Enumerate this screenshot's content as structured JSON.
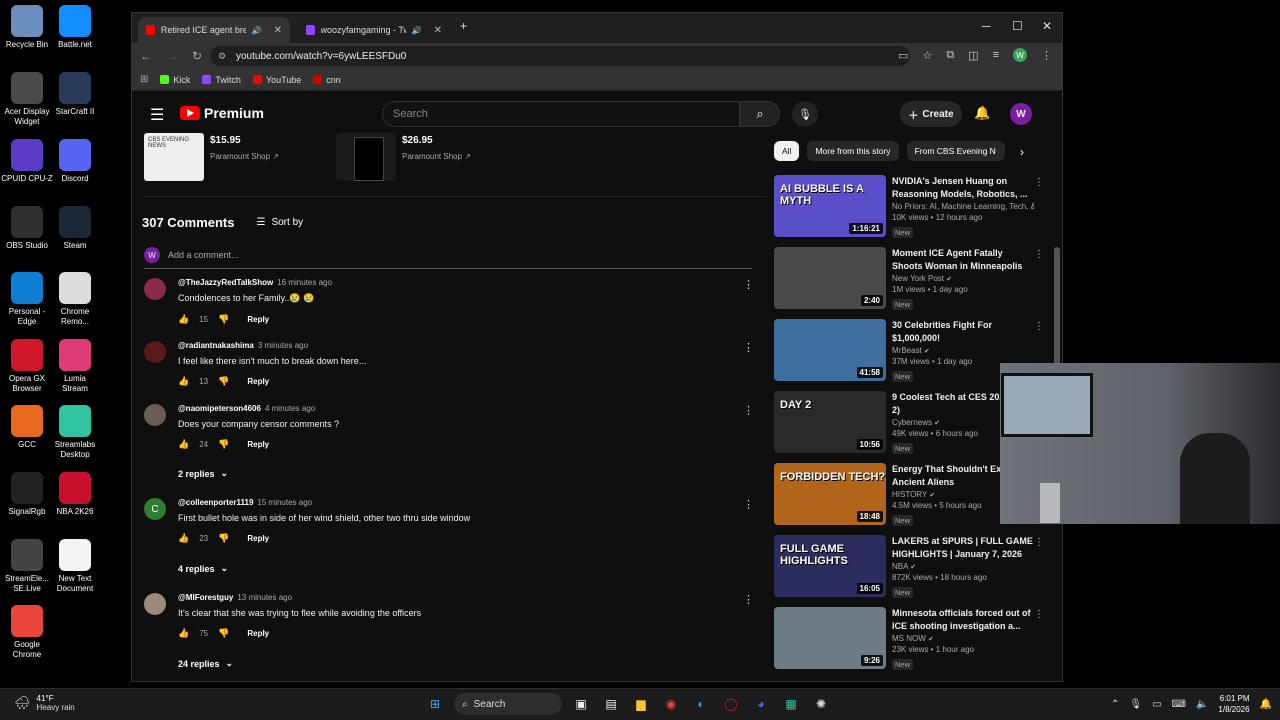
{
  "desktop": {
    "icons": [
      {
        "label": "Recycle Bin",
        "icon": "recycle-bin-icon",
        "color": "#6a8fbf"
      },
      {
        "label": "Battle.net",
        "icon": "battlenet-icon",
        "color": "#148eff"
      },
      {
        "label": "Acer Display\nWidget",
        "icon": "acer-icon",
        "color": "#4a4a4a"
      },
      {
        "label": "StarCraft II",
        "icon": "starcraft-icon",
        "color": "#2a3a5a"
      },
      {
        "label": "CPUID CPU-Z",
        "icon": "cpuz-icon",
        "color": "#5b3cc4"
      },
      {
        "label": "Discord",
        "icon": "discord-icon",
        "color": "#5865f2"
      },
      {
        "label": "OBS Studio",
        "icon": "obs-icon",
        "color": "#302e31"
      },
      {
        "label": "Steam",
        "icon": "steam-icon",
        "color": "#1b2838"
      },
      {
        "label": "Personal -\nEdge",
        "icon": "edge-icon",
        "color": "#0c7fd2"
      },
      {
        "label": "Chrome\nRemo...",
        "icon": "chrome-remote-icon",
        "color": "#ddd"
      },
      {
        "label": "Opera GX\nBrowser",
        "icon": "opera-gx-icon",
        "color": "#d1182b"
      },
      {
        "label": "Lumia\nStream",
        "icon": "lumia-icon",
        "color": "#e03a78"
      },
      {
        "label": "GCC",
        "icon": "gcc-icon",
        "color": "#e86a1f"
      },
      {
        "label": "Streamlabs\nDesktop",
        "icon": "streamlabs-icon",
        "color": "#31c3a2"
      },
      {
        "label": "SignalRgb",
        "icon": "signalrgb-icon",
        "color": "#222"
      },
      {
        "label": "NBA 2K26",
        "icon": "nba2k-icon",
        "color": "#c8102e"
      },
      {
        "label": "StreamEle...\nSE.Live",
        "icon": "streamelements-icon",
        "color": "#444"
      },
      {
        "label": "New Text\nDocument",
        "icon": "text-document-icon",
        "color": "#f4f4f4"
      },
      {
        "label": "Google\nChrome",
        "icon": "chrome-icon",
        "color": "#e8453c"
      }
    ]
  },
  "browser": {
    "tabs": [
      {
        "title": "Retired ICE agent breaks d",
        "favicon_color": "#ff0000"
      },
      {
        "title": "woozyfamgaming - Twitch",
        "favicon_color": "#9146ff"
      }
    ],
    "new_tab": "+",
    "url": "youtube.com/watch?v=6ywLEESFDu0",
    "profile_initial": "W",
    "bookmarks": [
      {
        "label": "Kick",
        "color": "#53fc18"
      },
      {
        "label": "Twitch",
        "color": "#9146ff"
      },
      {
        "label": "YouTube",
        "color": "#ff0000"
      },
      {
        "label": "cnn",
        "color": "#cc0000"
      }
    ]
  },
  "youtube": {
    "logo_text": "Premium",
    "search_placeholder": "Search",
    "create_label": "Create",
    "avatar_initial": "W"
  },
  "merch": [
    {
      "price": "$15.95",
      "shop": "Paramount Shop",
      "img_text": "CBS EVENING NEWS"
    },
    {
      "price": "$26.95",
      "shop": "Paramount Shop"
    }
  ],
  "comments_section": {
    "count": "307 Comments",
    "sort_label": "Sort by",
    "add_placeholder": "Add a comment...",
    "avatar_initial": "W",
    "comments": [
      {
        "author": "@TheJazzyRedTalkShow",
        "time": "16 minutes ago",
        "text": "Condolences to her Family..😢 😢",
        "likes": "15",
        "reply_label": "Reply",
        "avatar_color": "#8b2a4a",
        "avatar_letter": ""
      },
      {
        "author": "@radiantnakashima",
        "time": "3 minutes ago",
        "text": "I feel like there isn't much to break down here...",
        "likes": "13",
        "reply_label": "Reply",
        "avatar_color": "#5a1a1a",
        "avatar_letter": ""
      },
      {
        "author": "@naomipeterson4606",
        "time": "4 minutes ago",
        "text": "Does your company censor comments ?",
        "likes": "24",
        "reply_label": "Reply",
        "avatar_color": "#6b5d55",
        "avatar_letter": "",
        "replies": "2 replies"
      },
      {
        "author": "@colleenporter1119",
        "time": "15 minutes ago",
        "text": "First bullet hole was in side of her wind shield, other two thru side window",
        "likes": "23",
        "reply_label": "Reply",
        "avatar_color": "#2e7d32",
        "avatar_letter": "C",
        "replies": "4 replies"
      },
      {
        "author": "@MIForestguy",
        "time": "13 minutes ago",
        "text": "It's clear that she was trying to flee while avoiding the officers",
        "likes": "75",
        "reply_label": "Reply",
        "avatar_color": "#9c8b7a",
        "avatar_letter": "",
        "replies": "24 replies"
      }
    ]
  },
  "chips": [
    "All",
    "More from this story",
    "From CBS Evening N"
  ],
  "recommendations": [
    {
      "title": "NVIDIA's Jensen Huang on Reasoning Models, Robotics, ...",
      "channel": "No Priors: AI, Machine Learning, Tech, & ...",
      "stats": "10K views • 12 hours ago",
      "badge": "New",
      "duration": "1:16:21",
      "thumb_color": "#5a4fc8",
      "thumb_text": "AI BUBBLE IS A MYTH",
      "verified": false
    },
    {
      "title": "Moment ICE Agent Fatally Shoots Woman in Minneapolis",
      "channel": "New York Post",
      "stats": "1M views • 1 day ago",
      "badge": "New",
      "duration": "2:40",
      "thumb_color": "#4a4a4a",
      "thumb_text": "",
      "verified": true
    },
    {
      "title": "30 Celebrities Fight For $1,000,000!",
      "channel": "MrBeast",
      "stats": "37M views • 1 day ago",
      "badge": "New",
      "duration": "41:58",
      "thumb_color": "#3d6e9e",
      "thumb_text": "",
      "verified": true
    },
    {
      "title": "9 Coolest Tech at CES 2026 (Day 2)",
      "channel": "Cybernews",
      "stats": "49K views • 6 hours ago",
      "badge": "New",
      "duration": "10:56",
      "thumb_color": "#2a2a2a",
      "thumb_text": "DAY 2",
      "verified": true
    },
    {
      "title": "Energy That Shouldn't Exist: Ancient Aliens",
      "channel": "HISTORY",
      "stats": "4.5M views • 5 hours ago",
      "badge": "New",
      "duration": "18:48",
      "thumb_color": "#b0651a",
      "thumb_text": "FORBIDDEN TECH?",
      "verified": true
    },
    {
      "title": "LAKERS at SPURS | FULL GAME HIGHLIGHTS | January 7, 2026",
      "channel": "NBA",
      "stats": "872K views • 18 hours ago",
      "badge": "New",
      "duration": "16:05",
      "thumb_color": "#2c2c5e",
      "thumb_text": "FULL GAME HIGHLIGHTS",
      "verified": true
    },
    {
      "title": "Minnesota officials forced out of ICE shooting investigation a...",
      "channel": "MS NOW",
      "stats": "23K views • 1 hour ago",
      "badge": "New",
      "duration": "9:26",
      "thumb_color": "#6e7a84",
      "thumb_text": "",
      "verified": true
    }
  ],
  "taskbar": {
    "temp": "41°F",
    "weather": "Heavy rain",
    "search_label": "Search",
    "time": "6:01 PM",
    "date": "1/8/2026"
  }
}
